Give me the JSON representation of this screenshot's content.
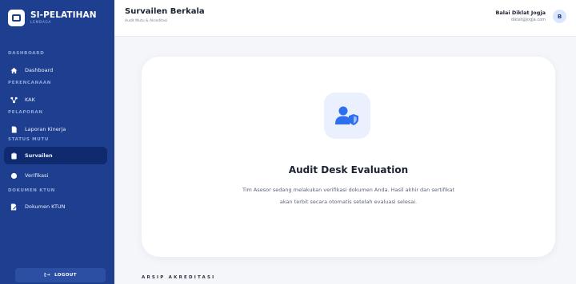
{
  "brand": {
    "title": "SI-PELATIHAN",
    "subtitle": "LEMBAGA"
  },
  "sidebar": {
    "sections": [
      {
        "label": "DASHBOARD"
      },
      {
        "label": "PERENCANAAN"
      },
      {
        "label": "PELAPORAN"
      },
      {
        "label": "STATUS MUTU"
      },
      {
        "label": "DOKUMEN KTUN"
      }
    ],
    "items": [
      {
        "label": "Dashboard",
        "icon": "home-icon"
      },
      {
        "label": "KAK",
        "icon": "sitemap-icon"
      },
      {
        "label": "Laporan Kinerja",
        "icon": "document-icon"
      },
      {
        "label": "Survailen",
        "icon": "clipboard-icon",
        "active": true
      },
      {
        "label": "Verifikasi",
        "icon": "dot-icon"
      },
      {
        "label": "Dokumen KTUN",
        "icon": "file-pen-icon"
      }
    ],
    "logout_label": "LOGOUT",
    "logout_glyph": "[→"
  },
  "header": {
    "title": "Survailen Berkala",
    "breadcrumb": "Audit Mutu & Akreditasi",
    "user_name": "Balai Diklat Jogja",
    "user_email": "diklat@jogja.com",
    "avatar_initial": "B"
  },
  "card": {
    "icon": "user-shield-icon",
    "title": "Audit Desk Evaluation",
    "description": "Tim Asesor sedang melakukan verifikasi dokumen Anda. Hasil akhir dan sertifikat akan terbit secara otomatis setelah evaluasi selesai."
  },
  "archive_heading": "ARSIP AKREDITASI",
  "colors": {
    "sidebar": "#1e3f8f",
    "active": "#0f2a6e",
    "accent": "#2f6fed"
  }
}
